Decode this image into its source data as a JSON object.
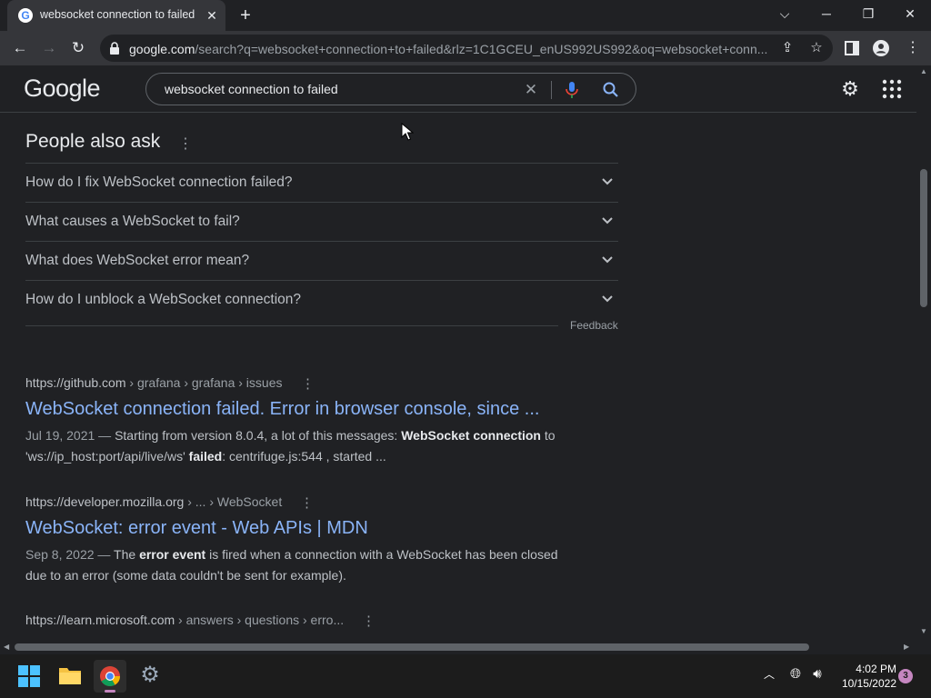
{
  "browser": {
    "tab_title": "websocket connection to failed - ",
    "tab_favicon": "G",
    "url_domain": "google.com",
    "url_rest": "/search?q=websocket+connection+to+failed&rlz=1C1GCEU_enUS992US992&oq=websocket+conn...",
    "icons": [
      "back-arrow-icon",
      "forward-arrow-icon",
      "reload-icon",
      "lock-icon",
      "share-icon",
      "star-icon",
      "side-panel-icon",
      "profile-icon",
      "kebab-menu-icon"
    ]
  },
  "google": {
    "logo": "Google",
    "query": "websocket connection to failed"
  },
  "paa": {
    "title": "People also ask",
    "questions": [
      "How do I fix WebSocket connection failed?",
      "What causes a WebSocket to fail?",
      "What does WebSocket error mean?",
      "How do I unblock a WebSocket connection?"
    ],
    "feedback": "Feedback"
  },
  "results": [
    {
      "domain": "https://github.com",
      "path": " › grafana › grafana › issues",
      "title": "WebSocket connection failed. Error in browser console, since ...",
      "date": "Jul 19, 2021 — ",
      "s1": "Starting from version 8.0.4, a lot of this messages: ",
      "b1": "WebSocket connection",
      "s2": " to 'ws://ip_host:port/api/live/ws' ",
      "b2": "failed",
      "s3": ": centrifuge.js:544 , started ..."
    },
    {
      "domain": "https://developer.mozilla.org",
      "path": " › ... › WebSocket",
      "title": "WebSocket: error event - Web APIs | MDN",
      "date": "Sep 8, 2022 — ",
      "s1": "The ",
      "b1": "error event",
      "s2": " is fired when a connection with a WebSocket has been closed due to an error (some data couldn't be sent for example).",
      "b2": "",
      "s3": ""
    },
    {
      "domain": "https://learn.microsoft.com",
      "path": " › answers › questions › erro...",
      "title": "",
      "date": "",
      "s1": "",
      "b1": "",
      "s2": "",
      "b2": "",
      "s3": ""
    }
  ],
  "taskbar": {
    "apps": [
      "windows-start-icon",
      "file-explorer-icon",
      "chrome-icon",
      "settings-icon"
    ],
    "time": "4:02 PM",
    "date": "10/15/2022",
    "notifications": "3"
  },
  "colors": {
    "background": "#202124",
    "link": "#8ab4f8",
    "toolbar": "#35363a"
  }
}
